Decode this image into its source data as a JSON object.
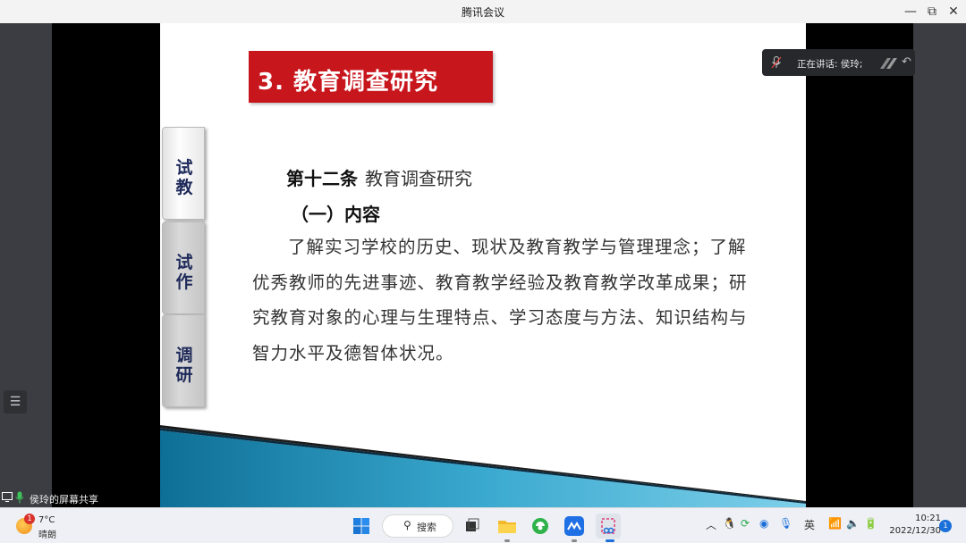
{
  "window": {
    "title": "腾讯会议",
    "minimize_glyph": "—",
    "maximize_glyph": "⧉",
    "close_glyph": "✕"
  },
  "slide": {
    "title": "3. 教育调查研究",
    "tabs": [
      {
        "line1": "试",
        "line2": "教"
      },
      {
        "line1": "试",
        "line2": "作"
      },
      {
        "line1": "调",
        "line2": "研"
      }
    ],
    "article_number": "第十二条",
    "article_name": "教育调查研究",
    "section": "（一）内容",
    "body": "了解实习学校的历史、现状及教育教学与管理理念；了解优秀教师的先进事迹、教育教学经验及教育教学改革成果；研究教育对象的心理与生理特点、学习态度与方法、知识结构与智力水平及德智体状况。"
  },
  "speaking": {
    "label": "正在讲话: 侯玲;"
  },
  "share": {
    "label": "侯玲的屏幕共享"
  },
  "taskbar": {
    "weather": {
      "temp": "7°C",
      "condition": "晴朗",
      "badge": "1"
    },
    "search_label": "搜索",
    "ime": "英",
    "time": "10:21",
    "date": "2022/12/30",
    "notification_count": "1"
  },
  "colors": {
    "title_red": "#c8161d",
    "tab_text": "#1e2a5a",
    "accent_blue": "#1a6fd8"
  }
}
